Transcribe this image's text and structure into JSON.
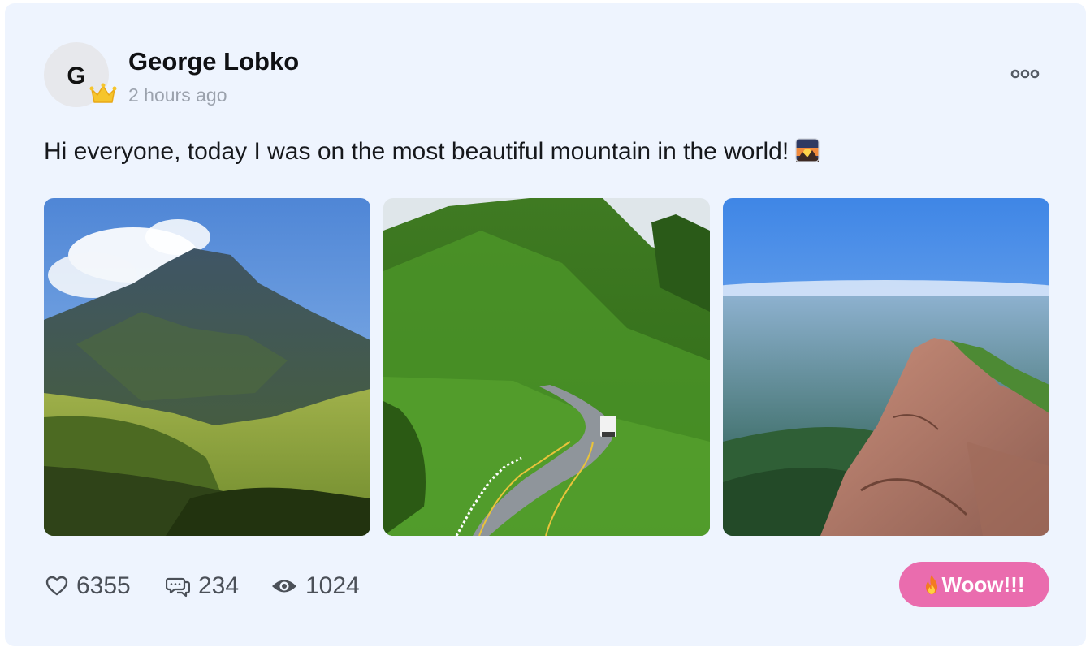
{
  "post": {
    "author": {
      "name": "George Lobko",
      "initial": "G",
      "badge_icon": "crown-icon"
    },
    "timestamp": "2 hours ago",
    "text": "Hi everyone, today I was on the most beautiful mountain in the world!",
    "text_emoji": "sunrise-over-mountains-icon",
    "photos": [
      {
        "subject": "green-mountain-peak"
      },
      {
        "subject": "winding-mountain-road"
      },
      {
        "subject": "rocky-summit-over-valley"
      }
    ],
    "stats": {
      "likes": "6355",
      "comments": "234",
      "views": "1024"
    },
    "reaction": {
      "icon": "fire-icon",
      "label": "Woow!!!",
      "color": "#ea6cae"
    }
  },
  "colors": {
    "card_background": "#eef4fe",
    "muted_text": "#9ba2ad",
    "stat_text": "#4b5058"
  }
}
